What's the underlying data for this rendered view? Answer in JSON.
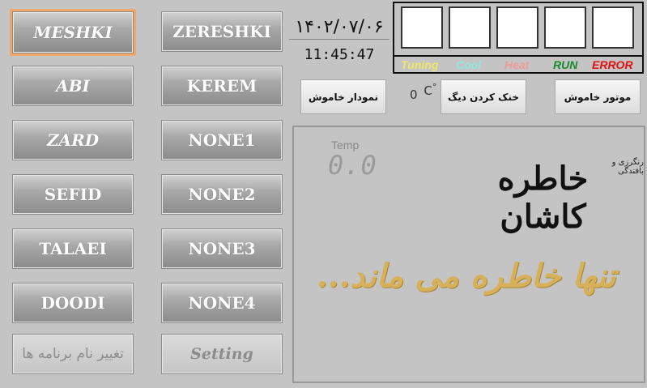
{
  "programs_left": [
    {
      "label": "MESHKI",
      "style": "italic",
      "selected": true
    },
    {
      "label": "ABI",
      "style": "italic"
    },
    {
      "label": "ZARD",
      "style": "italic"
    },
    {
      "label": "SEFID",
      "style": "normal"
    },
    {
      "label": "TALAEI",
      "style": "normal"
    },
    {
      "label": "DOODI",
      "style": "normal"
    }
  ],
  "programs_right": [
    {
      "label": "ZERESHKI"
    },
    {
      "label": "KEREM"
    },
    {
      "label": "NONE1"
    },
    {
      "label": "NONE2"
    },
    {
      "label": "NONE3"
    },
    {
      "label": "NONE4"
    }
  ],
  "rename_programs_label": "تغيير نام برنامه ها",
  "setting_label": "Setting",
  "clock": {
    "date": "۱۴۰۲/۰۷/۰۶",
    "time": "11:45:47"
  },
  "status": {
    "tuning": {
      "label": "Tuning",
      "color": "#f2e66a"
    },
    "cool": {
      "label": "Cool",
      "color": "#8fe8e0"
    },
    "heat": {
      "label": "Heat",
      "color": "#f09a98"
    },
    "run": {
      "label": "RUN",
      "color": "#1a8a2a"
    },
    "error": {
      "label": "ERROR",
      "color": "#e01010"
    }
  },
  "controls": {
    "chart_off_label": "نمودار خاموش",
    "cool_pot_label": "خنک کردن دیگ",
    "motor_off_label": "موتور خاموش",
    "temp_reading": "0",
    "temp_unit": "C",
    "degree_symbol": "°"
  },
  "display": {
    "temp_label": "Temp",
    "temp_value": "0.0",
    "logo_title": "خاطره کاشان",
    "logo_subtitle": "رنگرزی و بافندگی",
    "slogan": "تنها خاطره می ماند..."
  }
}
